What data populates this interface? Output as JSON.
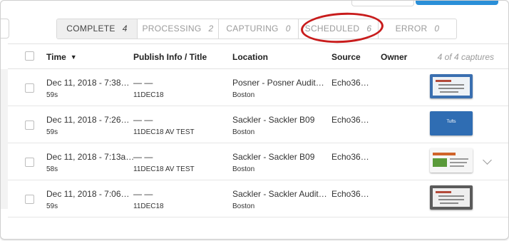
{
  "tabs": [
    {
      "label": "COMPLETE",
      "count": "4",
      "active": true
    },
    {
      "label": "PROCESSING",
      "count": "2",
      "active": false
    },
    {
      "label": "CAPTURING",
      "count": "0",
      "active": false
    },
    {
      "label": "SCHEDULED",
      "count": "6",
      "active": false
    },
    {
      "label": "ERROR",
      "count": "0",
      "active": false
    }
  ],
  "table": {
    "columns": {
      "time": "Time",
      "publish": "Publish Info / Title",
      "location": "Location",
      "source": "Source",
      "owner": "Owner"
    },
    "capture_count": "4 of 4 captures",
    "rows": [
      {
        "time": "Dec 11, 2018 - 7:38…",
        "duration": "59s",
        "publish": "— —",
        "title": "11DEC18",
        "location": "Posner - Posner Audit…",
        "city": "Boston",
        "source": "Echo36…",
        "thumb": "slide"
      },
      {
        "time": "Dec 11, 2018 - 7:26…",
        "duration": "59s",
        "publish": "— —",
        "title": "11DEC18 AV TEST",
        "location": "Sackler - Sackler B09",
        "city": "Boston",
        "source": "Echo36…",
        "thumb": "blue",
        "thumb_text": "Tufts"
      },
      {
        "time": "Dec 11, 2018 - 7:13a…",
        "duration": "58s",
        "publish": "— —",
        "title": "11DEC18 AV TEST",
        "location": "Sackler - Sackler B09",
        "city": "Boston",
        "source": "Echo36…",
        "thumb": "slide"
      },
      {
        "time": "Dec 11, 2018 - 7:06…",
        "duration": "59s",
        "publish": "— —",
        "title": "11DEC18",
        "location": "Sackler - Sackler Audit…",
        "city": "Boston",
        "source": "Echo36…",
        "thumb": "slide"
      }
    ]
  },
  "colors": {
    "annotation_circle": "#c81c1c",
    "primary_button": "#2a8fd8",
    "active_tab_bg": "#efefef"
  },
  "icons": {
    "sort": "caret-down-icon",
    "expand": "chevron-down-icon"
  }
}
